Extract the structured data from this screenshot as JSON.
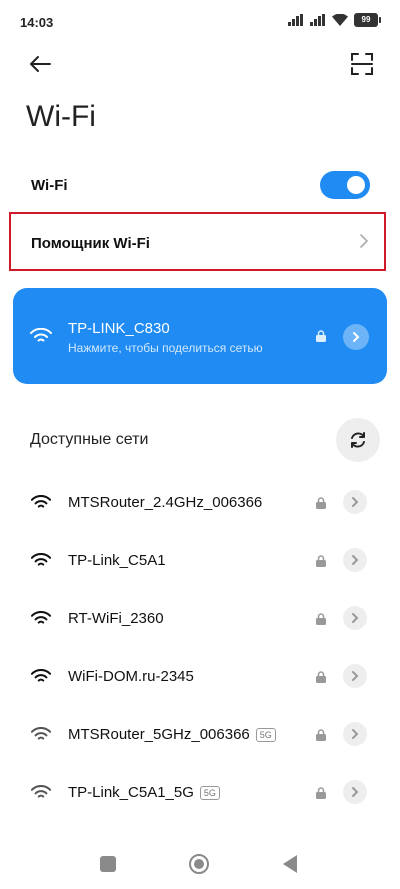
{
  "status_bar": {
    "time": "14:03",
    "battery": "99"
  },
  "header": {
    "title": "Wi-Fi"
  },
  "wifi_toggle": {
    "label": "Wi-Fi",
    "enabled": true
  },
  "assistant": {
    "label": "Помощник Wi-Fi"
  },
  "connected_network": {
    "ssid": "TP-LINK_C830",
    "subtitle": "Нажмите, чтобы поделиться сетью",
    "secured": true
  },
  "available_section": {
    "title": "Доступные сети"
  },
  "networks": [
    {
      "ssid": "MTSRouter_2.4GHz_006366",
      "band": "",
      "secured": true
    },
    {
      "ssid": "TP-Link_C5A1",
      "band": "",
      "secured": true
    },
    {
      "ssid": "RT-WiFi_2360",
      "band": "",
      "secured": true
    },
    {
      "ssid": "WiFi-DOM.ru-2345",
      "band": "",
      "secured": true
    },
    {
      "ssid": "MTSRouter_5GHz_006366",
      "band": "5G",
      "secured": true
    },
    {
      "ssid": "TP-Link_C5A1_5G",
      "band": "5G",
      "secured": true
    }
  ],
  "colors": {
    "accent": "#1f8bf3",
    "highlight_border": "#d01a2a"
  }
}
